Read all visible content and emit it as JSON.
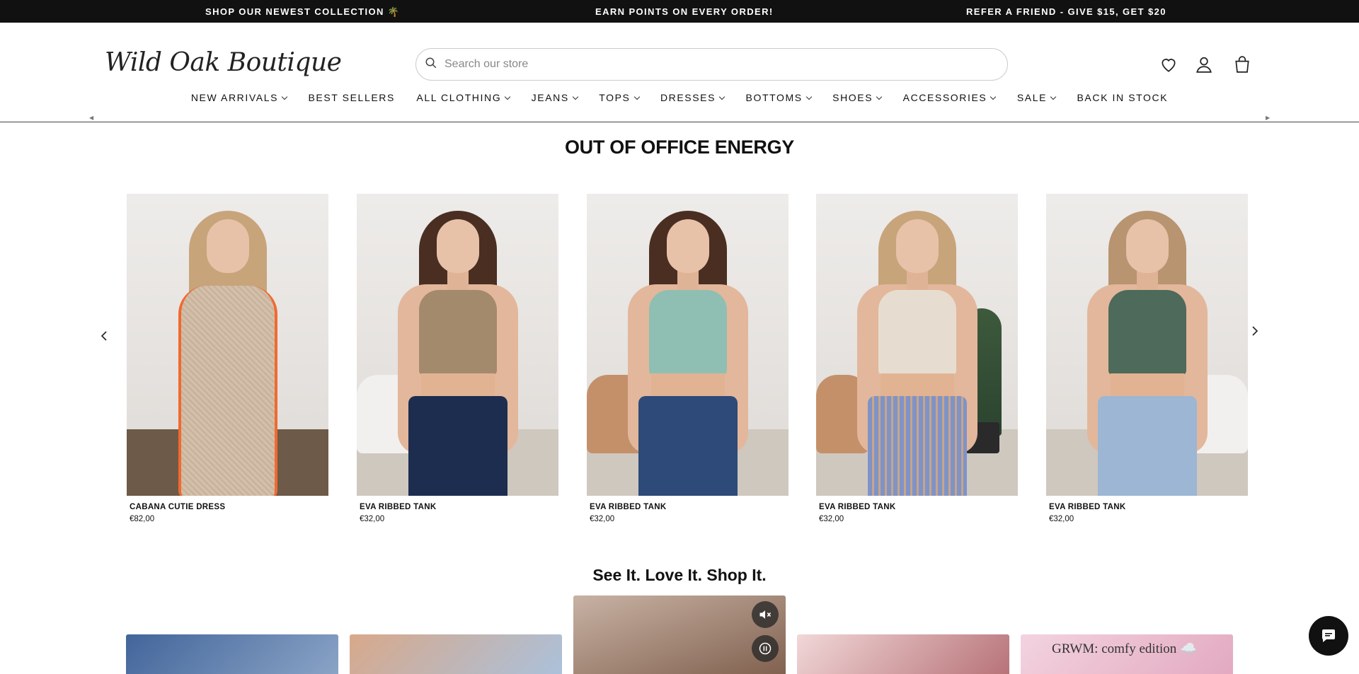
{
  "announcements": [
    "SHOP OUR NEWEST COLLECTION 🌴",
    "EARN POINTS ON EVERY ORDER!",
    "REFER A FRIEND - GIVE $15, GET $20"
  ],
  "header": {
    "logo_text": "Wild Oak Boutique",
    "search_placeholder": "Search our store",
    "icons": [
      "heart-icon",
      "account-icon",
      "cart-icon"
    ]
  },
  "nav": [
    {
      "label": "NEW ARRIVALS",
      "dropdown": true
    },
    {
      "label": "BEST SELLERS",
      "dropdown": false
    },
    {
      "label": "ALL CLOTHING",
      "dropdown": true
    },
    {
      "label": "JEANS",
      "dropdown": true
    },
    {
      "label": "TOPS",
      "dropdown": true
    },
    {
      "label": "DRESSES",
      "dropdown": true
    },
    {
      "label": "BOTTOMS",
      "dropdown": true
    },
    {
      "label": "SHOES",
      "dropdown": true
    },
    {
      "label": "ACCESSORIES",
      "dropdown": true
    },
    {
      "label": "SALE",
      "dropdown": true
    },
    {
      "label": "BACK IN STOCK",
      "dropdown": false
    }
  ],
  "featured": {
    "title": "OUT OF OFFICE ENERGY",
    "products": [
      {
        "name": "CABANA CUTIE DRESS",
        "price": "€82,00",
        "top_color": "#d4c0ab",
        "bottom_color": "#d4c0ab"
      },
      {
        "name": "EVA RIBBED TANK",
        "price": "€32,00",
        "top_color": "#a48a6c",
        "bottom_color": "#1d2d4f"
      },
      {
        "name": "EVA RIBBED TANK",
        "price": "€32,00",
        "top_color": "#8fbfb2",
        "bottom_color": "#2d4a78"
      },
      {
        "name": "EVA RIBBED TANK",
        "price": "€32,00",
        "top_color": "#e6ddd0",
        "bottom_color": "#7f93c7"
      },
      {
        "name": "EVA RIBBED TANK",
        "price": "€32,00",
        "top_color": "#4d6a5a",
        "bottom_color": "#9cb6d4"
      }
    ]
  },
  "shop_it": {
    "title": "See It. Love It. Shop It.",
    "video_caption": "GRWM: comfy edition ☁️"
  },
  "colors": {
    "announcement_bg": "#111111",
    "chat_bg": "#111111"
  }
}
